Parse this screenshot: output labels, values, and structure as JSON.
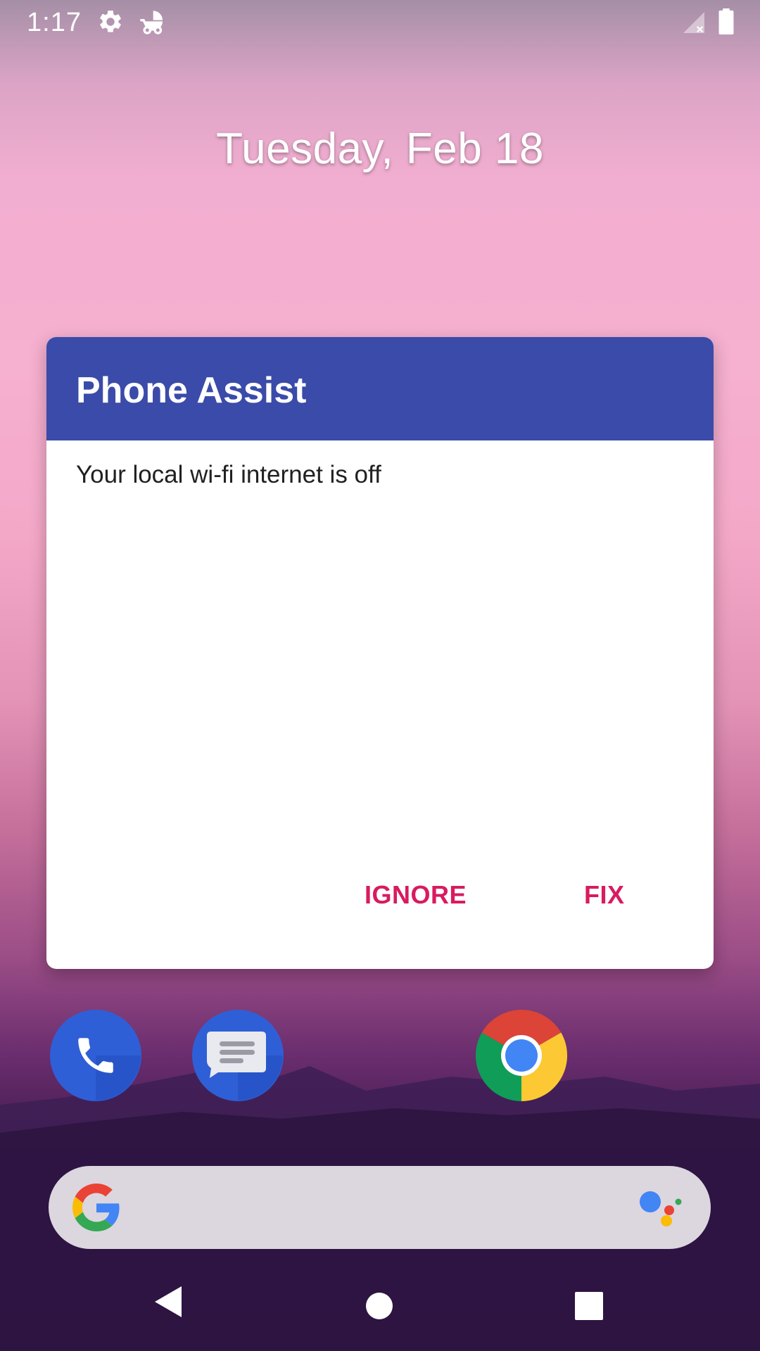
{
  "status_bar": {
    "time": "1:17",
    "icons": [
      "gear-icon",
      "stroller-icon",
      "signal-off-icon",
      "battery-icon"
    ]
  },
  "home": {
    "date": "Tuesday, Feb 18"
  },
  "dialog": {
    "title": "Phone Assist",
    "message": "Your local wi-fi internet is off",
    "buttons": {
      "ignore": "IGNORE",
      "fix": "FIX"
    },
    "colors": {
      "header": "#3a4ba9",
      "button_text": "#d81b60"
    }
  },
  "dock": {
    "apps": [
      "phone-app-icon",
      "messages-app-icon",
      "chrome-app-icon"
    ]
  },
  "search_bar": {
    "icons": [
      "google-g-icon",
      "assistant-icon"
    ]
  },
  "nav_bar": {
    "buttons": [
      "back-icon",
      "home-icon",
      "recents-icon"
    ]
  }
}
